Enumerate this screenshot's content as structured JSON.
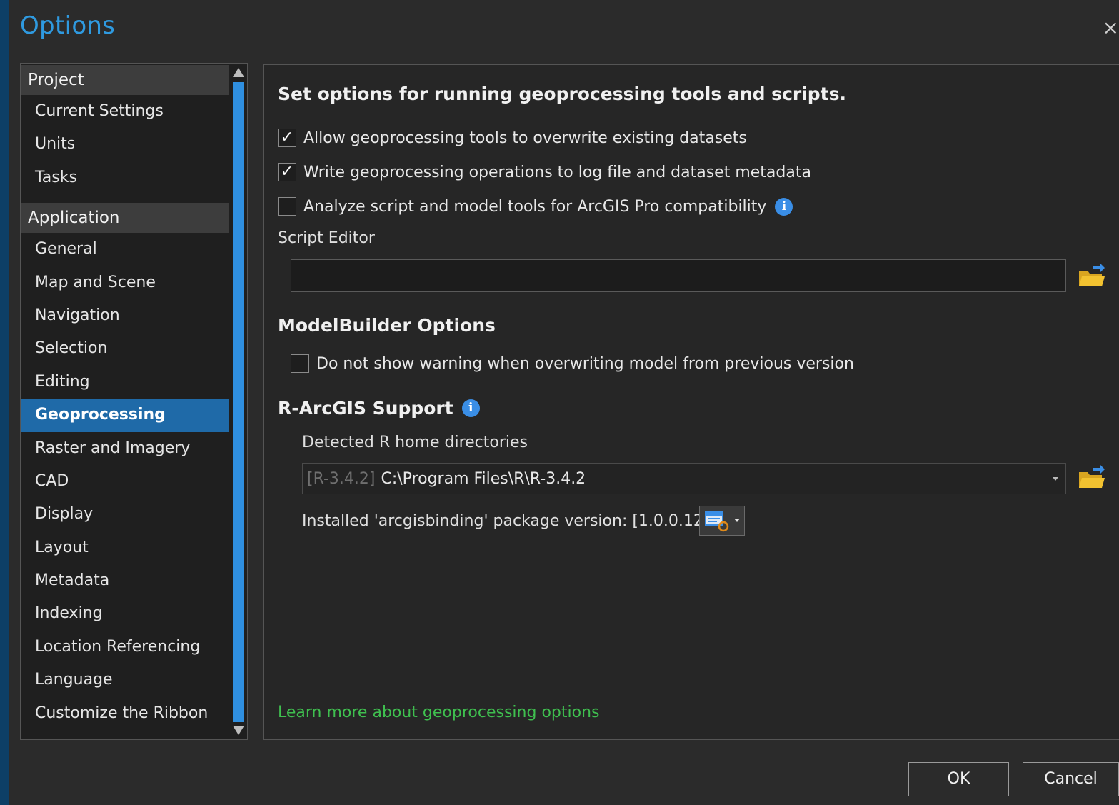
{
  "window": {
    "title": "Options",
    "close_label": "×"
  },
  "nav": {
    "groups": [
      {
        "label": "Project",
        "items": [
          "Current Settings",
          "Units",
          "Tasks"
        ]
      },
      {
        "label": "Application",
        "items": [
          "General",
          "Map and Scene",
          "Navigation",
          "Selection",
          "Editing",
          "Geoprocessing",
          "Raster and Imagery",
          "CAD",
          "Display",
          "Layout",
          "Metadata",
          "Indexing",
          "Location Referencing",
          "Language",
          "Customize the Ribbon"
        ]
      }
    ],
    "selected": "Geoprocessing"
  },
  "content": {
    "heading": "Set options for running geoprocessing tools and scripts.",
    "checks": [
      {
        "label": "Allow geoprocessing tools to overwrite existing datasets",
        "checked": true
      },
      {
        "label": "Write geoprocessing operations to log file and dataset metadata",
        "checked": true
      },
      {
        "label": "Analyze script and model tools for ArcGIS Pro compatibility",
        "checked": false
      }
    ],
    "script_editor": {
      "label": "Script Editor",
      "value": ""
    },
    "modelbuilder": {
      "heading": "ModelBuilder Options",
      "check_label": "Do not show warning when overwriting model from previous version",
      "checked": false
    },
    "r_support": {
      "heading": "R-ArcGIS Support",
      "detected_label": "Detected R home directories",
      "selected_version": "[R-3.4.2]",
      "selected_path": "C:\\Program Files\\R\\R-3.4.2",
      "package_label": "Installed 'arcgisbinding' package version: [1.0.0.128]"
    },
    "learn_more": "Learn more about geoprocessing options"
  },
  "buttons": {
    "ok": "OK",
    "cancel": "Cancel"
  },
  "colors": {
    "accent": "#2f9ae0",
    "selected": "#1f6aa8",
    "link": "#3fbf4f",
    "info": "#3a8ee6",
    "folder": "#f2c230"
  },
  "icons": [
    "info-icon",
    "folder-open-icon",
    "check-icon",
    "refresh-package-icon",
    "dropdown-arrow-icon",
    "close-icon"
  ]
}
